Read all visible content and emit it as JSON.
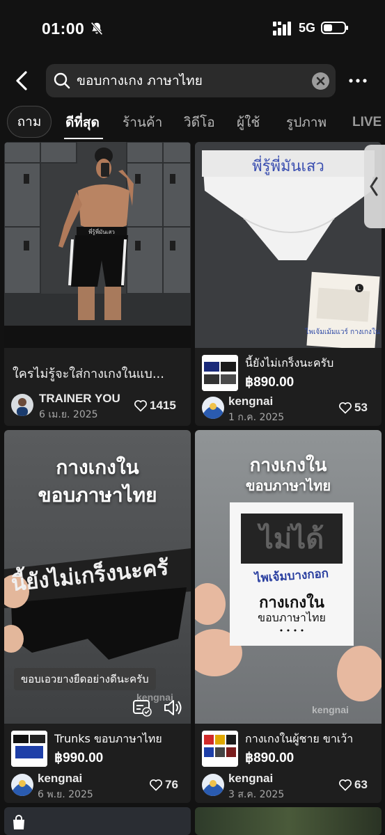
{
  "status_bar": {
    "time": "01:00",
    "network": "5G"
  },
  "search": {
    "query": "ขอบกางเกง ภาษาไทย",
    "placeholder": ""
  },
  "tabs": [
    "ถาม",
    "ดีที่สุด",
    "ร้านค้า",
    "วิดีโอ",
    "ผู้ใช้",
    "รูปภาพ",
    "LIVE"
  ],
  "active_tab": "ดีที่สุด",
  "posts": [
    {
      "caption": "ใครไม่รู้จะใส่กางเกงในแบ...",
      "username": "TRAINER YOU",
      "date": "6 เม.ย. 2025",
      "likes": "1415",
      "image_text": "พี่รู้พี่มันเสว"
    },
    {
      "product_title": "นี้ยังไม่เกร็งนะครับ",
      "product_price": "฿890.00",
      "username": "kengnai",
      "date": "1 ก.ค. 2025",
      "likes": "53",
      "image_text": "พี่รู้พี่มันเสว",
      "box_text": "ไพเจ้มเม้มแวร์ กางเกงใน",
      "size_label": "L"
    },
    {
      "overlay_line1": "กางเกงใน",
      "overlay_line2": "ขอบภาษาไทย",
      "band_text": "นี้ยังไม่เกร็งนะครั",
      "subtitle": "ขอบเอวยางยืดอย่างดีนะครับ",
      "watermark": "kengnai",
      "product_title": "Trunks ขอบภาษาไทย",
      "product_price": "฿990.00",
      "username": "kengnai",
      "date": "6 พ.ย. 2025",
      "likes": "76"
    },
    {
      "overlay_line1": "กางเกงใน",
      "overlay_line2": "ขอบภาษาไทย",
      "box_line1": "ไม่ได้",
      "box_line2": "ไพเจ้มบางกอก",
      "box_line3": "กางเกงใน",
      "box_line4": "ขอบภาษาไทย",
      "box_dots": "• • • •",
      "watermark": "kengnai",
      "product_title": "กางเกงในผู้ชาย ขาเว้า",
      "product_price": "฿890.00",
      "username": "kengnai",
      "date": "3 ส.ค. 2025",
      "likes": "63"
    }
  ]
}
